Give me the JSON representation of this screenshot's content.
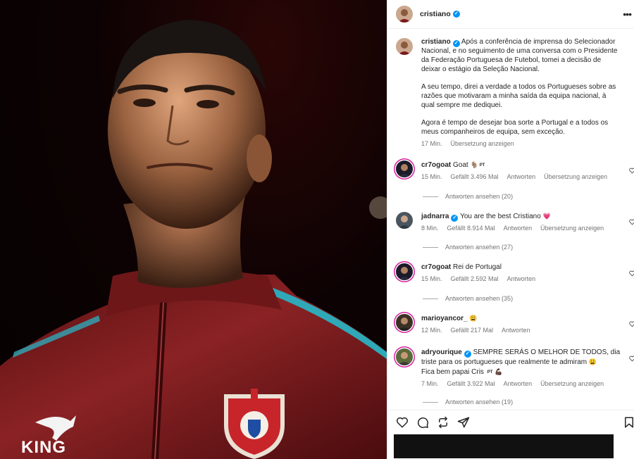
{
  "post": {
    "username": "cristiano",
    "caption": [
      "Após a conferência de imprensa do Selecionador Nacional, e no seguimento de uma conversa com o Presidente da Federação Portuguesa de Futebol, tomei a decisão de deixar o estágio da Seleção Nacional.",
      "A seu tempo, direi a verdade a todos os Portugueses sobre as razões que motivaram a minha saída da equipa nacional, à qual sempre me dediquei.",
      "Agora é tempo de desejar boa sorte a Portugal e a todos os meus companheiros de equipa, sem exceção."
    ],
    "time": "17 Min.",
    "translate": "Übersetzung anzeigen"
  },
  "photo": {
    "brand_text": "KING",
    "jacket_color": "#7a1a1c",
    "stripe_color": "#2fa8b8"
  },
  "comments": [
    {
      "username": "cr7ogoat",
      "text": "Goat",
      "emoji": "🐐",
      "pt": "PT",
      "time": "15 Min.",
      "likes": "Gefällt 3.496 Mal",
      "reply": "Antworten",
      "translate": "Übersetzung anzeigen",
      "view_replies": "Antworten ansehen (20)"
    },
    {
      "username": "jadnarra",
      "verified": true,
      "text": "You are the best Cristiano",
      "emoji": "💗",
      "time": "8 Min.",
      "likes": "Gefällt 8.914 Mal",
      "reply": "Antworten",
      "translate": "Übersetzung anzeigen",
      "view_replies": "Antworten ansehen (27)"
    },
    {
      "username": "cr7ogoat",
      "text": "Rei de Portugal",
      "time": "15 Min.",
      "likes": "Gefällt 2.592 Mal",
      "reply": "Antworten",
      "view_replies": "Antworten ansehen (35)"
    },
    {
      "username": "marioyancor_",
      "emoji": "😩",
      "time": "12 Min.",
      "likes": "Gefällt 217 Mal",
      "reply": "Antworten"
    },
    {
      "username": "adryourique",
      "verified": true,
      "text_1": "SEMPRE SERÁS O MELHOR DE TODOS, dia triste para os portugueses que realmente te admiram",
      "emoji_1": "😩",
      "text_2": "Fica bem papai Cris",
      "pt": "PT",
      "emoji_2": "💪🏿",
      "time": "7 Min.",
      "likes": "Gefällt 3.922 Mal",
      "reply": "Antworten",
      "translate": "Übersetzung anzeigen",
      "view_replies": "Antworten ansehen (19)"
    }
  ],
  "icons": {
    "like": "heart-icon",
    "comment": "comment-icon",
    "share": "repost-icon",
    "send": "send-icon",
    "save": "bookmark-icon",
    "more": "more-icon"
  },
  "colors": {
    "verified": "#0095f6",
    "meta": "#737373",
    "story_ring": "#d6249f"
  }
}
